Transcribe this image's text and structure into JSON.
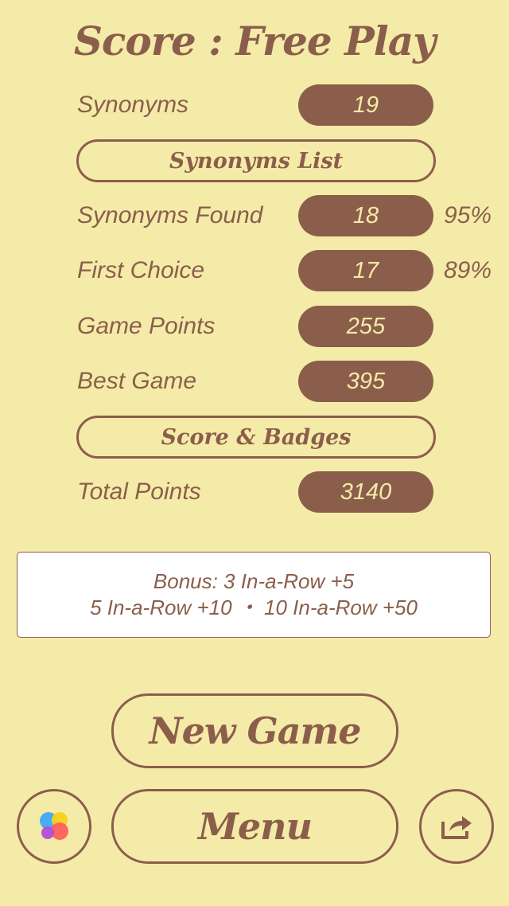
{
  "title": "Score : Free Play",
  "stats": {
    "synonyms": {
      "label": "Synonyms",
      "value": "19"
    },
    "synonyms_list_button": "Synonyms List",
    "found": {
      "label": "Synonyms Found",
      "value": "18",
      "pct": "95%"
    },
    "first_choice": {
      "label": "First Choice",
      "value": "17",
      "pct": "89%"
    },
    "game_points": {
      "label": "Game Points",
      "value": "255"
    },
    "best_game": {
      "label": "Best Game",
      "value": "395"
    },
    "score_badges_button": "Score & Badges",
    "total_points": {
      "label": "Total Points",
      "value": "3140"
    }
  },
  "bonus": {
    "line1": "Bonus: 3 In-a-Row +5",
    "line2": "5 In-a-Row +10 ・ 10 In-a-Row +50"
  },
  "buttons": {
    "new_game": "New Game",
    "menu": "Menu"
  },
  "icons": {
    "game_center": "game-center-icon",
    "share": "share-icon"
  },
  "colors": {
    "background": "#f5eba8",
    "accent": "#8b5e4b",
    "pill_text": "#f5eba8"
  }
}
